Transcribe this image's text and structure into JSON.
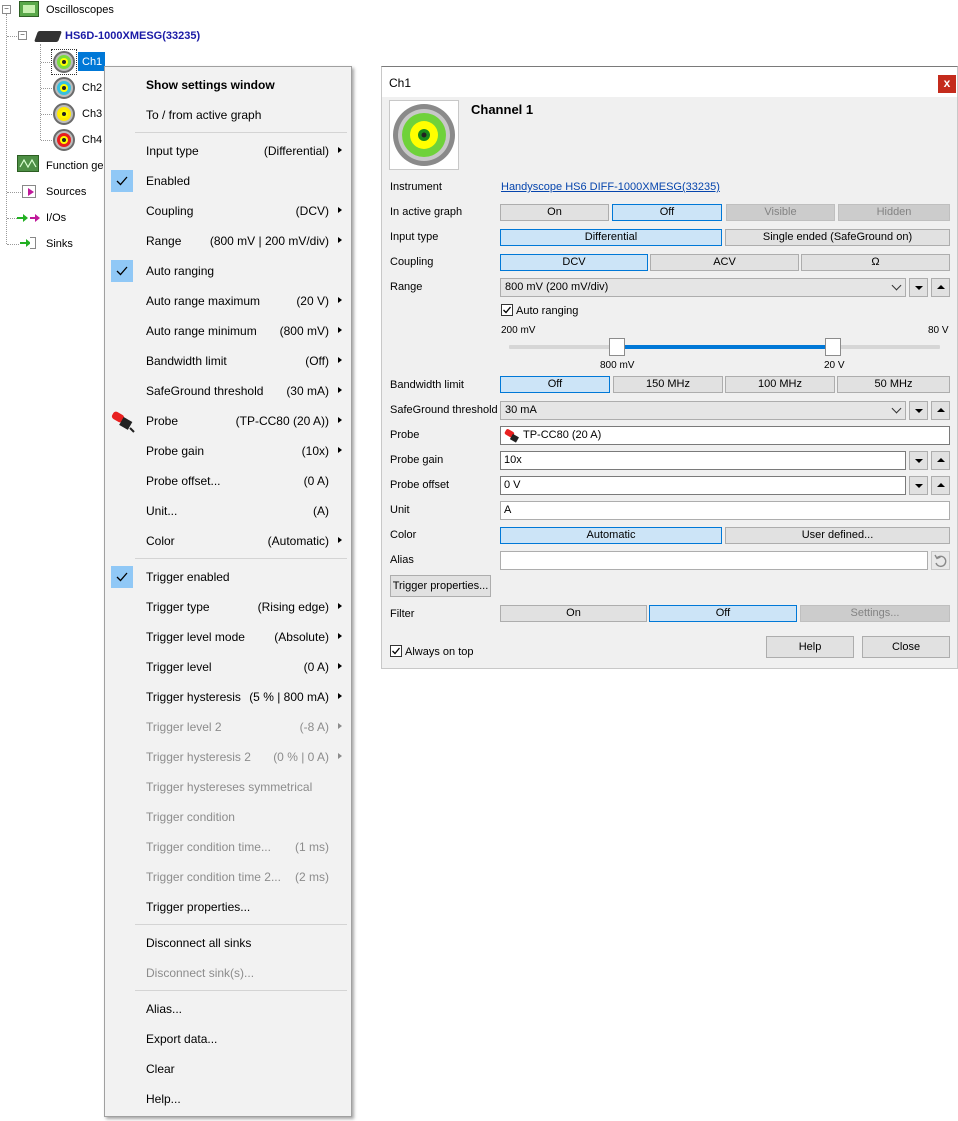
{
  "tree": {
    "root": "Oscilloscopes",
    "device": "HS6D-1000XMESG(33235)",
    "channels": [
      {
        "label": "Ch1",
        "ring": "#2ecc40",
        "inner": "#ffff00",
        "outer": "#7cdc3c"
      },
      {
        "label": "Ch2",
        "ring": "#3cc8e6",
        "inner": "#ffff00",
        "outer": "#36c0e0"
      },
      {
        "label": "Ch3",
        "ring": "#ffff00",
        "inner": "#ffff00",
        "outer": "#ffea00"
      },
      {
        "label": "Ch4",
        "ring": "#ff2020",
        "inner": "#ffff00",
        "outer": "#e81e1e"
      }
    ],
    "function_gen": "Function ger",
    "sources": "Sources",
    "ios": "I/Os",
    "sinks": "Sinks"
  },
  "menu": {
    "items": [
      {
        "label": "Show settings window",
        "value": "",
        "arrow": false
      },
      {
        "label": "To / from active graph",
        "value": "",
        "arrow": false
      },
      {
        "label": "Input type",
        "value": "(Differential)",
        "arrow": true
      },
      {
        "label": "Enabled",
        "value": "",
        "arrow": false
      },
      {
        "label": "Coupling",
        "value": "(DCV)",
        "arrow": true
      },
      {
        "label": "Range",
        "value": "(800 mV | 200 mV/div)",
        "arrow": true
      },
      {
        "label": "Auto ranging",
        "value": "",
        "arrow": false
      },
      {
        "label": "Auto range maximum",
        "value": "(20 V)",
        "arrow": true
      },
      {
        "label": "Auto range minimum",
        "value": "(800 mV)",
        "arrow": true
      },
      {
        "label": "Bandwidth limit",
        "value": "(Off)",
        "arrow": true
      },
      {
        "label": "SafeGround threshold",
        "value": "(30 mA)",
        "arrow": true
      },
      {
        "label": "Probe",
        "value": "(TP-CC80 (20 A))",
        "arrow": true
      },
      {
        "label": "Probe gain",
        "value": "(10x)",
        "arrow": true
      },
      {
        "label": "Probe offset...",
        "value": "(0 A)",
        "arrow": false
      },
      {
        "label": "Unit...",
        "value": "(A)",
        "arrow": false
      },
      {
        "label": "Color",
        "value": "(Automatic)",
        "arrow": true
      },
      {
        "label": "Trigger enabled",
        "value": "",
        "arrow": false
      },
      {
        "label": "Trigger type",
        "value": "(Rising edge)",
        "arrow": true
      },
      {
        "label": "Trigger level mode",
        "value": "(Absolute)",
        "arrow": true
      },
      {
        "label": "Trigger level",
        "value": "(0 A)",
        "arrow": true
      },
      {
        "label": "Trigger hysteresis",
        "value": "(5 % | 800 mA)",
        "arrow": true
      },
      {
        "label": "Trigger level 2",
        "value": "(-8 A)",
        "arrow": true
      },
      {
        "label": "Trigger hysteresis 2",
        "value": "(0 % | 0 A)",
        "arrow": true
      },
      {
        "label": "Trigger hystereses symmetrical",
        "value": "",
        "arrow": false
      },
      {
        "label": "Trigger condition",
        "value": "",
        "arrow": false
      },
      {
        "label": "Trigger condition time...",
        "value": "(1 ms)",
        "arrow": false
      },
      {
        "label": "Trigger condition time 2...",
        "value": "(2 ms)",
        "arrow": false
      },
      {
        "label": "Trigger properties...",
        "value": "",
        "arrow": false
      },
      {
        "label": "Disconnect all sinks",
        "value": "",
        "arrow": false
      },
      {
        "label": "Disconnect sink(s)...",
        "value": "",
        "arrow": false
      },
      {
        "label": "Alias...",
        "value": "",
        "arrow": false
      },
      {
        "label": "Export data...",
        "value": "",
        "arrow": false
      },
      {
        "label": "Clear",
        "value": "",
        "arrow": false
      },
      {
        "label": "Help...",
        "value": "",
        "arrow": false
      }
    ]
  },
  "window": {
    "title": "Ch1",
    "close_glyph": "x",
    "heading": "Channel 1",
    "instrument_label": "Instrument",
    "instrument_link": "Handyscope HS6 DIFF-1000XMESG(33235)",
    "active_graph_label": "In active graph",
    "active_graph": [
      "On",
      "Off",
      "Visible",
      "Hidden"
    ],
    "input_type_label": "Input type",
    "input_type": [
      "Differential",
      "Single ended (SafeGround on)"
    ],
    "coupling_label": "Coupling",
    "coupling": [
      "DCV",
      "ACV",
      "Ω"
    ],
    "range_label": "Range",
    "range_value": "800 mV (200 mV/div)",
    "auto_ranging": "Auto ranging",
    "slider_min": "200 mV",
    "slider_max": "80 V",
    "slider_low": "800 mV",
    "slider_high": "20 V",
    "bandwidth_label": "Bandwidth limit",
    "bandwidth": [
      "Off",
      "150 MHz",
      "100 MHz",
      "50 MHz"
    ],
    "safeground_label": "SafeGround threshold",
    "safeground_value": "30 mA",
    "probe_label": "Probe",
    "probe_value": "TP-CC80 (20 A)",
    "probe_gain_label": "Probe gain",
    "probe_gain_value": "10x",
    "probe_offset_label": "Probe offset",
    "probe_offset_value": "0 V",
    "unit_label": "Unit",
    "unit_value": "A",
    "color_label": "Color",
    "color": [
      "Automatic",
      "User defined..."
    ],
    "alias_label": "Alias",
    "alias_value": "",
    "trigger_props": "Trigger properties...",
    "filter_label": "Filter",
    "filter": [
      "On",
      "Off",
      "Settings..."
    ],
    "always_on_top": "Always on top",
    "help": "Help",
    "close": "Close"
  }
}
